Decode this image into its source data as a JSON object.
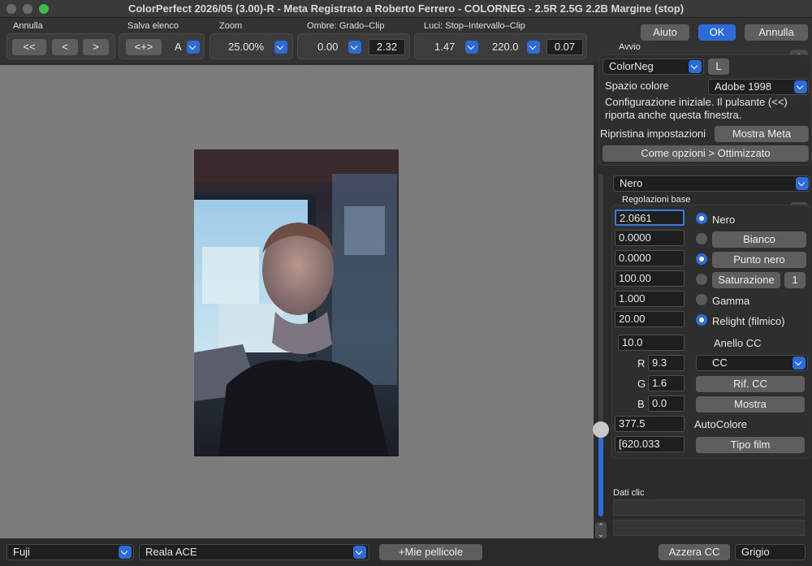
{
  "window": {
    "title": "ColorPerfect 2026/05 (3.00)-R -  Meta Registrato a Roberto Ferrero - COLORNEG - 2.5R 2.5G 2.2B Margine (stop)",
    "traffic_colors": [
      "#6a6a6a",
      "#6a6a6a",
      "#3dbd4c"
    ]
  },
  "header_buttons": {
    "aiuto": "Aiuto",
    "ok": "OK",
    "annulla": "Annulla"
  },
  "toolbar": {
    "annulla": {
      "label": "Annulla",
      "first": "<<",
      "prev": "<",
      "next": ">"
    },
    "salva": {
      "label": "Salva elenco",
      "button": "<+>",
      "slot": "A"
    },
    "zoom": {
      "label": "Zoom",
      "value": "25.00%"
    },
    "ombre": {
      "label": "Ombre: Grado–Clip",
      "grade": "0.00",
      "clip": "2.32"
    },
    "luci": {
      "label": "Luci: Stop–Intervallo–Clip",
      "stop": "1.47",
      "range": "220.0",
      "clip": "0.07"
    }
  },
  "avvio": {
    "header": "Avvio",
    "mode": "ColorNeg",
    "l_button": "L",
    "color_space_label": "Spazio colore",
    "color_space": "Adobe 1998",
    "note_line1": "Configurazione iniziale. Il pulsante (<<)",
    "note_line2": "riporta anche questa finestra.",
    "restore_label": "Ripristina impostazioni",
    "show_meta": "Mostra Meta",
    "options_button": "Come opzioni > Ottimizzato",
    "plus": "+"
  },
  "settings": {
    "section": "Nero",
    "sub_header": "Regolazioni base",
    "plus": "+",
    "rows": [
      {
        "value": "2.0661",
        "label": "Nero",
        "radio": true,
        "is_button": false
      },
      {
        "value": "0.0000",
        "label": "Bianco",
        "radio": false,
        "is_button": true
      },
      {
        "value": "0.0000",
        "label": "Punto nero",
        "radio": true,
        "is_button": true
      },
      {
        "value": "100.00",
        "label": "Saturazione",
        "radio": false,
        "is_button": true,
        "extra": "1"
      },
      {
        "value": "1.000",
        "label": "Gamma",
        "radio": false,
        "is_button": false
      },
      {
        "value": "20.00",
        "label": "Relight (filmico)",
        "radio": true,
        "is_button": false
      }
    ],
    "anello_value": "10.0",
    "anello_label": "Anello CC",
    "r_label": "R",
    "r_value": "9.3",
    "g_label": "G",
    "g_value": "1.6",
    "b_label": "B",
    "b_value": "0.0",
    "cc_select": "CC",
    "rif_cc": "Rif. CC",
    "mostra": "Mostra",
    "autocolor_value": "377.5",
    "autocolor_label": "AutoColore",
    "film_value": "[620.033",
    "tipo_film": "Tipo film"
  },
  "dati_clic": {
    "label": "Dati clic"
  },
  "bottom": {
    "brand": "Fuji",
    "film": "Reala ACE",
    "my_films": "+Mie pellicole",
    "reset_cc": "Azzera CC",
    "grey": "Grigio"
  },
  "slider": {
    "level": 0.15
  }
}
